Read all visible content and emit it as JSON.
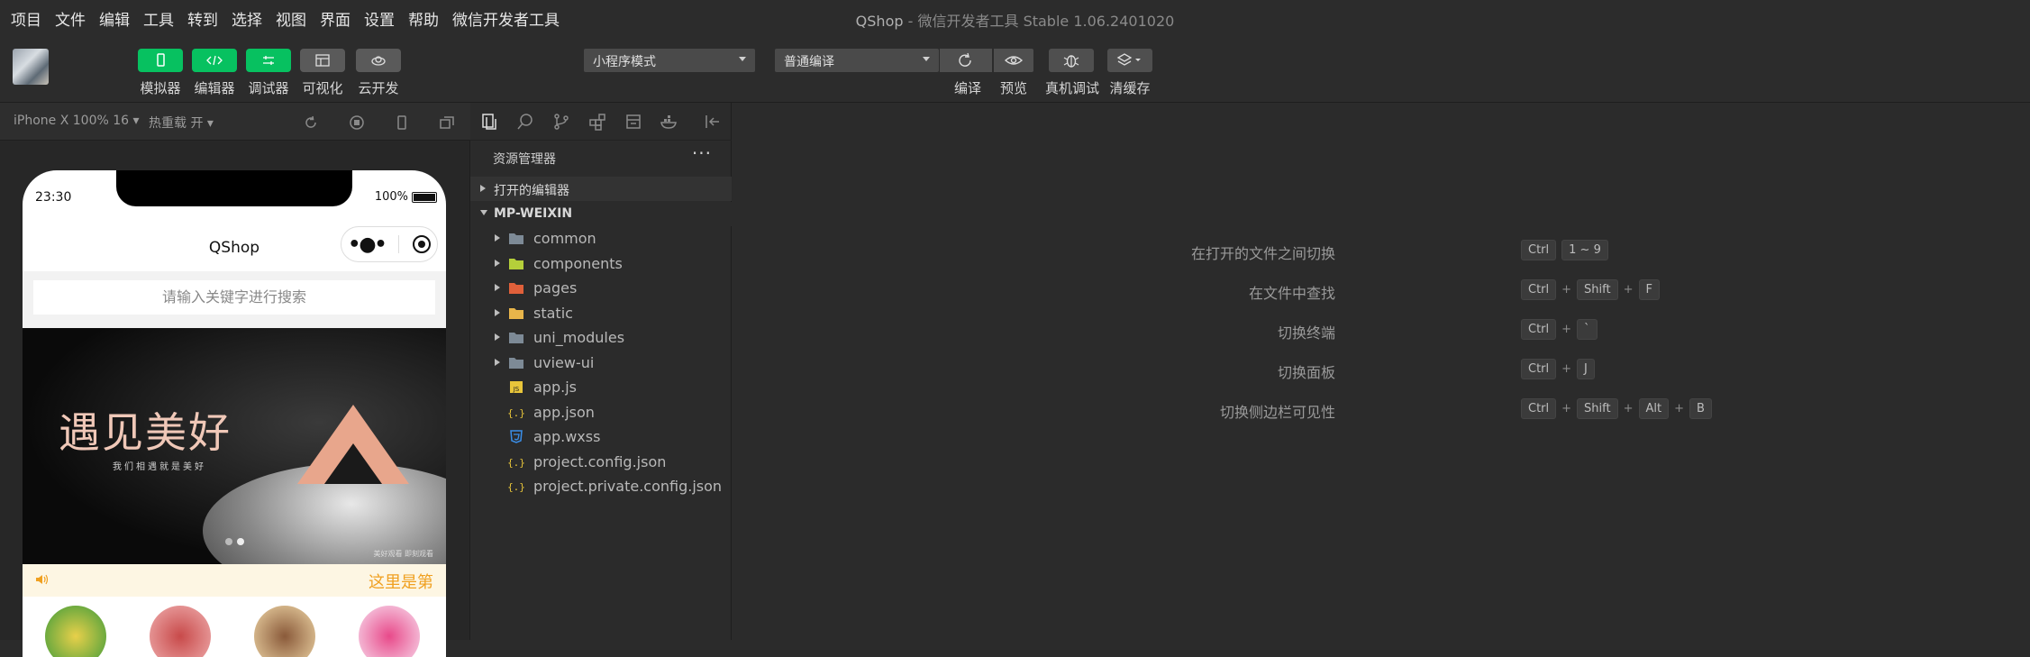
{
  "menu": [
    "项目",
    "文件",
    "编辑",
    "工具",
    "转到",
    "选择",
    "视图",
    "界面",
    "设置",
    "帮助",
    "微信开发者工具"
  ],
  "window_title": {
    "app": "QShop",
    "separator": "-",
    "suffix": "微信开发者工具 Stable 1.06.2401020"
  },
  "toolbar": {
    "left_buttons": [
      {
        "label": "模拟器",
        "icon": "phone-icon",
        "style": "green"
      },
      {
        "label": "编辑器",
        "icon": "code-icon",
        "style": "green"
      },
      {
        "label": "调试器",
        "icon": "debug-icon",
        "style": "green"
      },
      {
        "label": "可视化",
        "icon": "layout-icon",
        "style": "gray"
      },
      {
        "label": "云开发",
        "icon": "cloud-icon",
        "style": "gray"
      }
    ],
    "mode_select": "小程序模式",
    "compile_select": "普通编译",
    "right_buttons": [
      {
        "label": "编译",
        "icon": "refresh-icon"
      },
      {
        "label": "预览",
        "icon": "eye-icon"
      },
      {
        "label": "真机调试",
        "icon": "bug-icon"
      },
      {
        "label": "清缓存",
        "icon": "layers-icon"
      }
    ]
  },
  "simulator_bar": {
    "device": "iPhone X 100% 16 ▾",
    "hot_reload": "热重载 开 ▾"
  },
  "phone": {
    "time": "23:30",
    "battery": "100%",
    "nav_title": "QShop",
    "search_placeholder": "请输入关键字进行搜索",
    "banner_title": "遇见美好",
    "banner_subtitle": "我们相遇就是美好",
    "banner_caption": "美好观看 即刻观看",
    "notice": "这里是第"
  },
  "explorer": {
    "title": "资源管理器",
    "more": "···",
    "open_editors": "打开的编辑器",
    "project": "MP-WEIXIN",
    "items": [
      {
        "name": "common",
        "type": "folder",
        "icon": "folder-icon",
        "color": "#7d8a96"
      },
      {
        "name": "components",
        "type": "folder",
        "icon": "components-folder-icon",
        "color": "#b5cf3a"
      },
      {
        "name": "pages",
        "type": "folder",
        "icon": "pages-folder-icon",
        "color": "#e0603a"
      },
      {
        "name": "static",
        "type": "folder",
        "icon": "static-folder-icon",
        "color": "#e8b54a"
      },
      {
        "name": "uni_modules",
        "type": "folder",
        "icon": "folder-icon",
        "color": "#7d8a96"
      },
      {
        "name": "uview-ui",
        "type": "folder",
        "icon": "folder-icon",
        "color": "#7d8a96"
      },
      {
        "name": "app.js",
        "type": "file",
        "icon": "js-file-icon",
        "color": "#e8c53a"
      },
      {
        "name": "app.json",
        "type": "file",
        "icon": "json-file-icon",
        "color": "#e8c53a"
      },
      {
        "name": "app.wxss",
        "type": "file",
        "icon": "css-file-icon",
        "color": "#3a8ee8"
      },
      {
        "name": "project.config.json",
        "type": "file",
        "icon": "json-file-icon",
        "color": "#e8c53a"
      },
      {
        "name": "project.private.config.json",
        "type": "file",
        "icon": "json-file-icon",
        "color": "#e8c53a"
      }
    ]
  },
  "shortcuts": [
    {
      "desc": "在打开的文件之间切换",
      "keys": [
        "Ctrl",
        "1 ~ 9"
      ]
    },
    {
      "desc": "在文件中查找",
      "keys": [
        "Ctrl",
        "+",
        "Shift",
        "+",
        "F"
      ]
    },
    {
      "desc": "切换终端",
      "keys": [
        "Ctrl",
        "+",
        "`"
      ]
    },
    {
      "desc": "切换面板",
      "keys": [
        "Ctrl",
        "+",
        "J"
      ]
    },
    {
      "desc": "切换侧边栏可见性",
      "keys": [
        "Ctrl",
        "+",
        "Shift",
        "+",
        "Alt",
        "+",
        "B"
      ]
    }
  ]
}
